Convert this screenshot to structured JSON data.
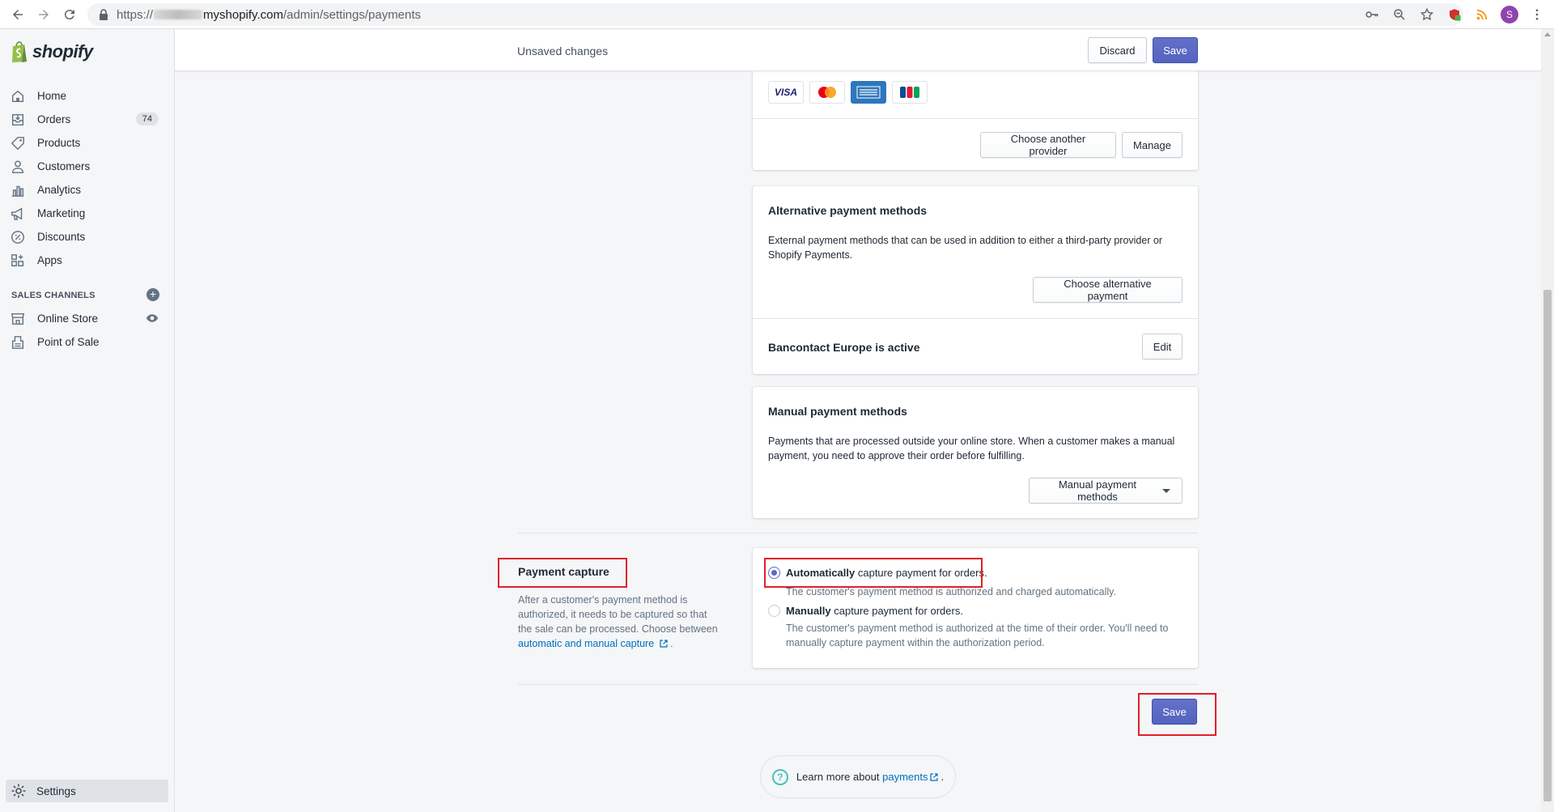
{
  "browser": {
    "url_scheme": "https://",
    "url_host": "myshopify.com",
    "url_path": "/admin/settings/payments",
    "profile_initial": "S"
  },
  "sidebar": {
    "brand": "shopify",
    "items": [
      {
        "label": "Home",
        "icon": "home-icon"
      },
      {
        "label": "Orders",
        "icon": "orders-icon",
        "badge": "74"
      },
      {
        "label": "Products",
        "icon": "tag-icon"
      },
      {
        "label": "Customers",
        "icon": "person-icon"
      },
      {
        "label": "Analytics",
        "icon": "bar-chart-icon"
      },
      {
        "label": "Marketing",
        "icon": "megaphone-icon"
      },
      {
        "label": "Discounts",
        "icon": "discount-icon"
      },
      {
        "label": "Apps",
        "icon": "apps-icon"
      }
    ],
    "sales_channels_heading": "SALES CHANNELS",
    "sales_channels": [
      {
        "label": "Online Store",
        "icon": "store-icon"
      },
      {
        "label": "Point of Sale",
        "icon": "pos-icon"
      }
    ],
    "settings_label": "Settings"
  },
  "topbar": {
    "status": "Unsaved changes",
    "discard_label": "Discard",
    "save_label": "Save"
  },
  "provider_card": {
    "card_brands": [
      "VISA",
      "Mastercard",
      "American Express",
      "JCB"
    ],
    "choose_another_label": "Choose another provider",
    "manage_label": "Manage"
  },
  "alternative_card": {
    "title": "Alternative payment methods",
    "description": "External payment methods that can be used in addition to either a third-party provider or Shopify Payments.",
    "choose_label": "Choose alternative payment",
    "active_title": "Bancontact Europe is active",
    "edit_label": "Edit"
  },
  "manual_card": {
    "title": "Manual payment methods",
    "description": "Payments that are processed outside your online store. When a customer makes a manual payment, you need to approve their order before fulfilling.",
    "dropdown_label": "Manual payment methods"
  },
  "payment_capture": {
    "title": "Payment capture",
    "description": "After a customer's payment method is authorized, it needs to be captured so that the sale can be processed. Choose between",
    "link_text": "automatic and manual capture",
    "trailing": ".",
    "options": [
      {
        "label_strong": "Automatically",
        "label_rest": " capture payment for orders.",
        "help": "The customer's payment method is authorized and charged automatically.",
        "checked": true
      },
      {
        "label_strong": "Manually",
        "label_rest": " capture payment for orders.",
        "help": "The customer's payment method is authorized at the time of their order. You'll need to manually capture payment within the authorization period.",
        "checked": false
      }
    ]
  },
  "footer": {
    "save_label": "Save",
    "learn_prefix": "Learn more about ",
    "learn_link": "payments",
    "learn_suffix": "."
  },
  "colors": {
    "primary": "#5c6ac4",
    "highlight": "#e0202b",
    "link": "#006fbb"
  }
}
